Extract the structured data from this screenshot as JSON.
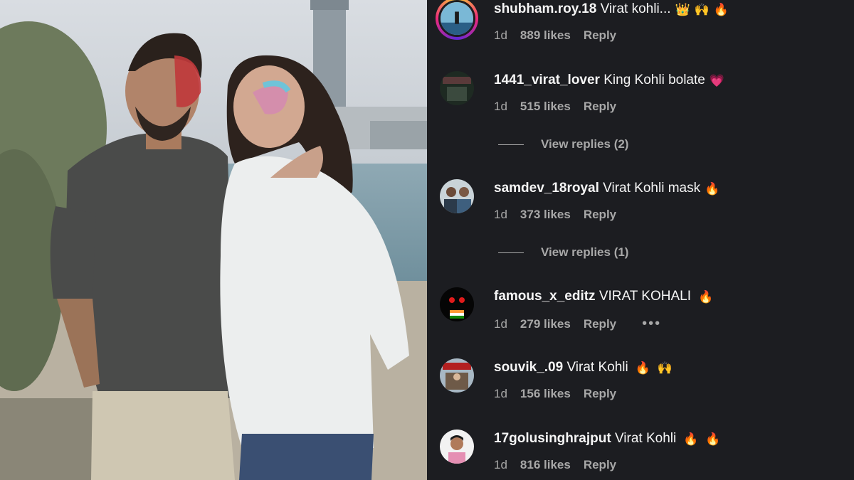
{
  "comments": [
    {
      "username": "shubham.roy.18",
      "text": "Virat kohli...",
      "emojis": [
        "👑",
        "🙌",
        "🔥"
      ],
      "age": "1d",
      "likes": "889 likes",
      "reply": "Reply"
    },
    {
      "username": "1441_virat_lover",
      "text": "King Kohli bolate",
      "emojis": [
        "💗"
      ],
      "age": "1d",
      "likes": "515 likes",
      "reply": "Reply",
      "view_replies": "View replies (2)"
    },
    {
      "username": "samdev_18royal",
      "text": "Virat Kohli mask",
      "emojis": [
        "🔥"
      ],
      "age": "1d",
      "likes": "373 likes",
      "reply": "Reply",
      "view_replies": "View replies (1)"
    },
    {
      "username": "famous_x_editz",
      "text": "VIRAT KOHALI",
      "emojis": [
        "🔥"
      ],
      "age": "1d",
      "likes": "279 likes",
      "reply": "Reply",
      "more": "•••"
    },
    {
      "username": "souvik_.09",
      "text": "Virat Kohli",
      "emojis": [
        "🔥",
        "🙌"
      ],
      "age": "1d",
      "likes": "156 likes",
      "reply": "Reply"
    },
    {
      "username": "17golusinghrajput",
      "text": "Virat Kohli",
      "emojis": [
        "🔥",
        "🔥"
      ],
      "age": "1d",
      "likes": "816 likes",
      "reply": "Reply"
    }
  ],
  "colors": {
    "background": "#1c1d21",
    "text": "#f5f5f5",
    "muted": "#a8a8a8"
  }
}
